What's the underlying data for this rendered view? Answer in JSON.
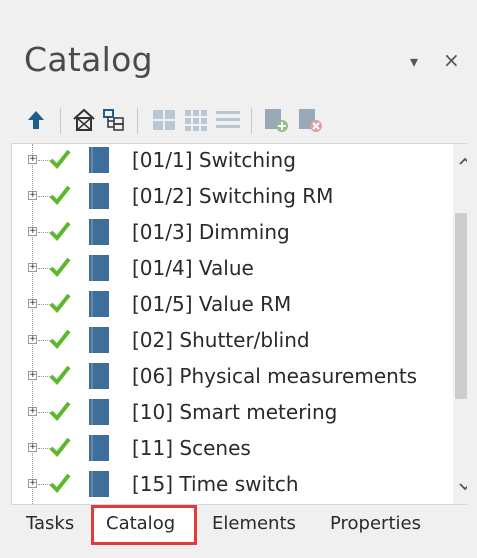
{
  "panel": {
    "title": "Catalog",
    "dropdown_glyph": "▾",
    "close_glyph": "×"
  },
  "toolbar": {
    "icons": [
      "up-arrow-icon",
      "building-icon",
      "tree-structure-icon",
      "large-tiles-icon",
      "small-tiles-icon",
      "list-view-icon",
      "add-item-icon",
      "delete-item-icon"
    ]
  },
  "tree": {
    "items": [
      {
        "label": "[01/1] Switching"
      },
      {
        "label": "[01/2] Switching RM"
      },
      {
        "label": "[01/3] Dimming"
      },
      {
        "label": "[01/4] Value"
      },
      {
        "label": "[01/5] Value RM"
      },
      {
        "label": "[02] Shutter/blind"
      },
      {
        "label": "[06] Physical measurements"
      },
      {
        "label": "[10] Smart metering"
      },
      {
        "label": "[11] Scenes"
      },
      {
        "label": "[15] Time switch"
      }
    ],
    "check_color": "#5cb82c",
    "book_color": "#3f6f99"
  },
  "tabs": [
    {
      "label": "Tasks"
    },
    {
      "label": "Catalog",
      "active": true
    },
    {
      "label": "Elements"
    },
    {
      "label": "Properties"
    }
  ],
  "highlight_color": "#e33b3b"
}
